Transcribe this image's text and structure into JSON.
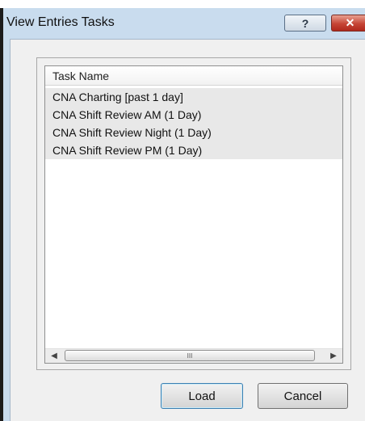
{
  "window": {
    "title": "View Entries Tasks"
  },
  "titlebar": {
    "help_glyph": "?",
    "close_glyph": "✕"
  },
  "list": {
    "header": "Task Name",
    "rows": [
      "CNA Charting [past 1 day]",
      "CNA Shift Review AM (1 Day)",
      "CNA Shift Review Night (1 Day)",
      "CNA Shift Review PM (1 Day)"
    ]
  },
  "scrollbar": {
    "left_arrow": "◀",
    "right_arrow": "▶",
    "grip": "III"
  },
  "buttons": {
    "load": "Load",
    "cancel": "Cancel"
  }
}
